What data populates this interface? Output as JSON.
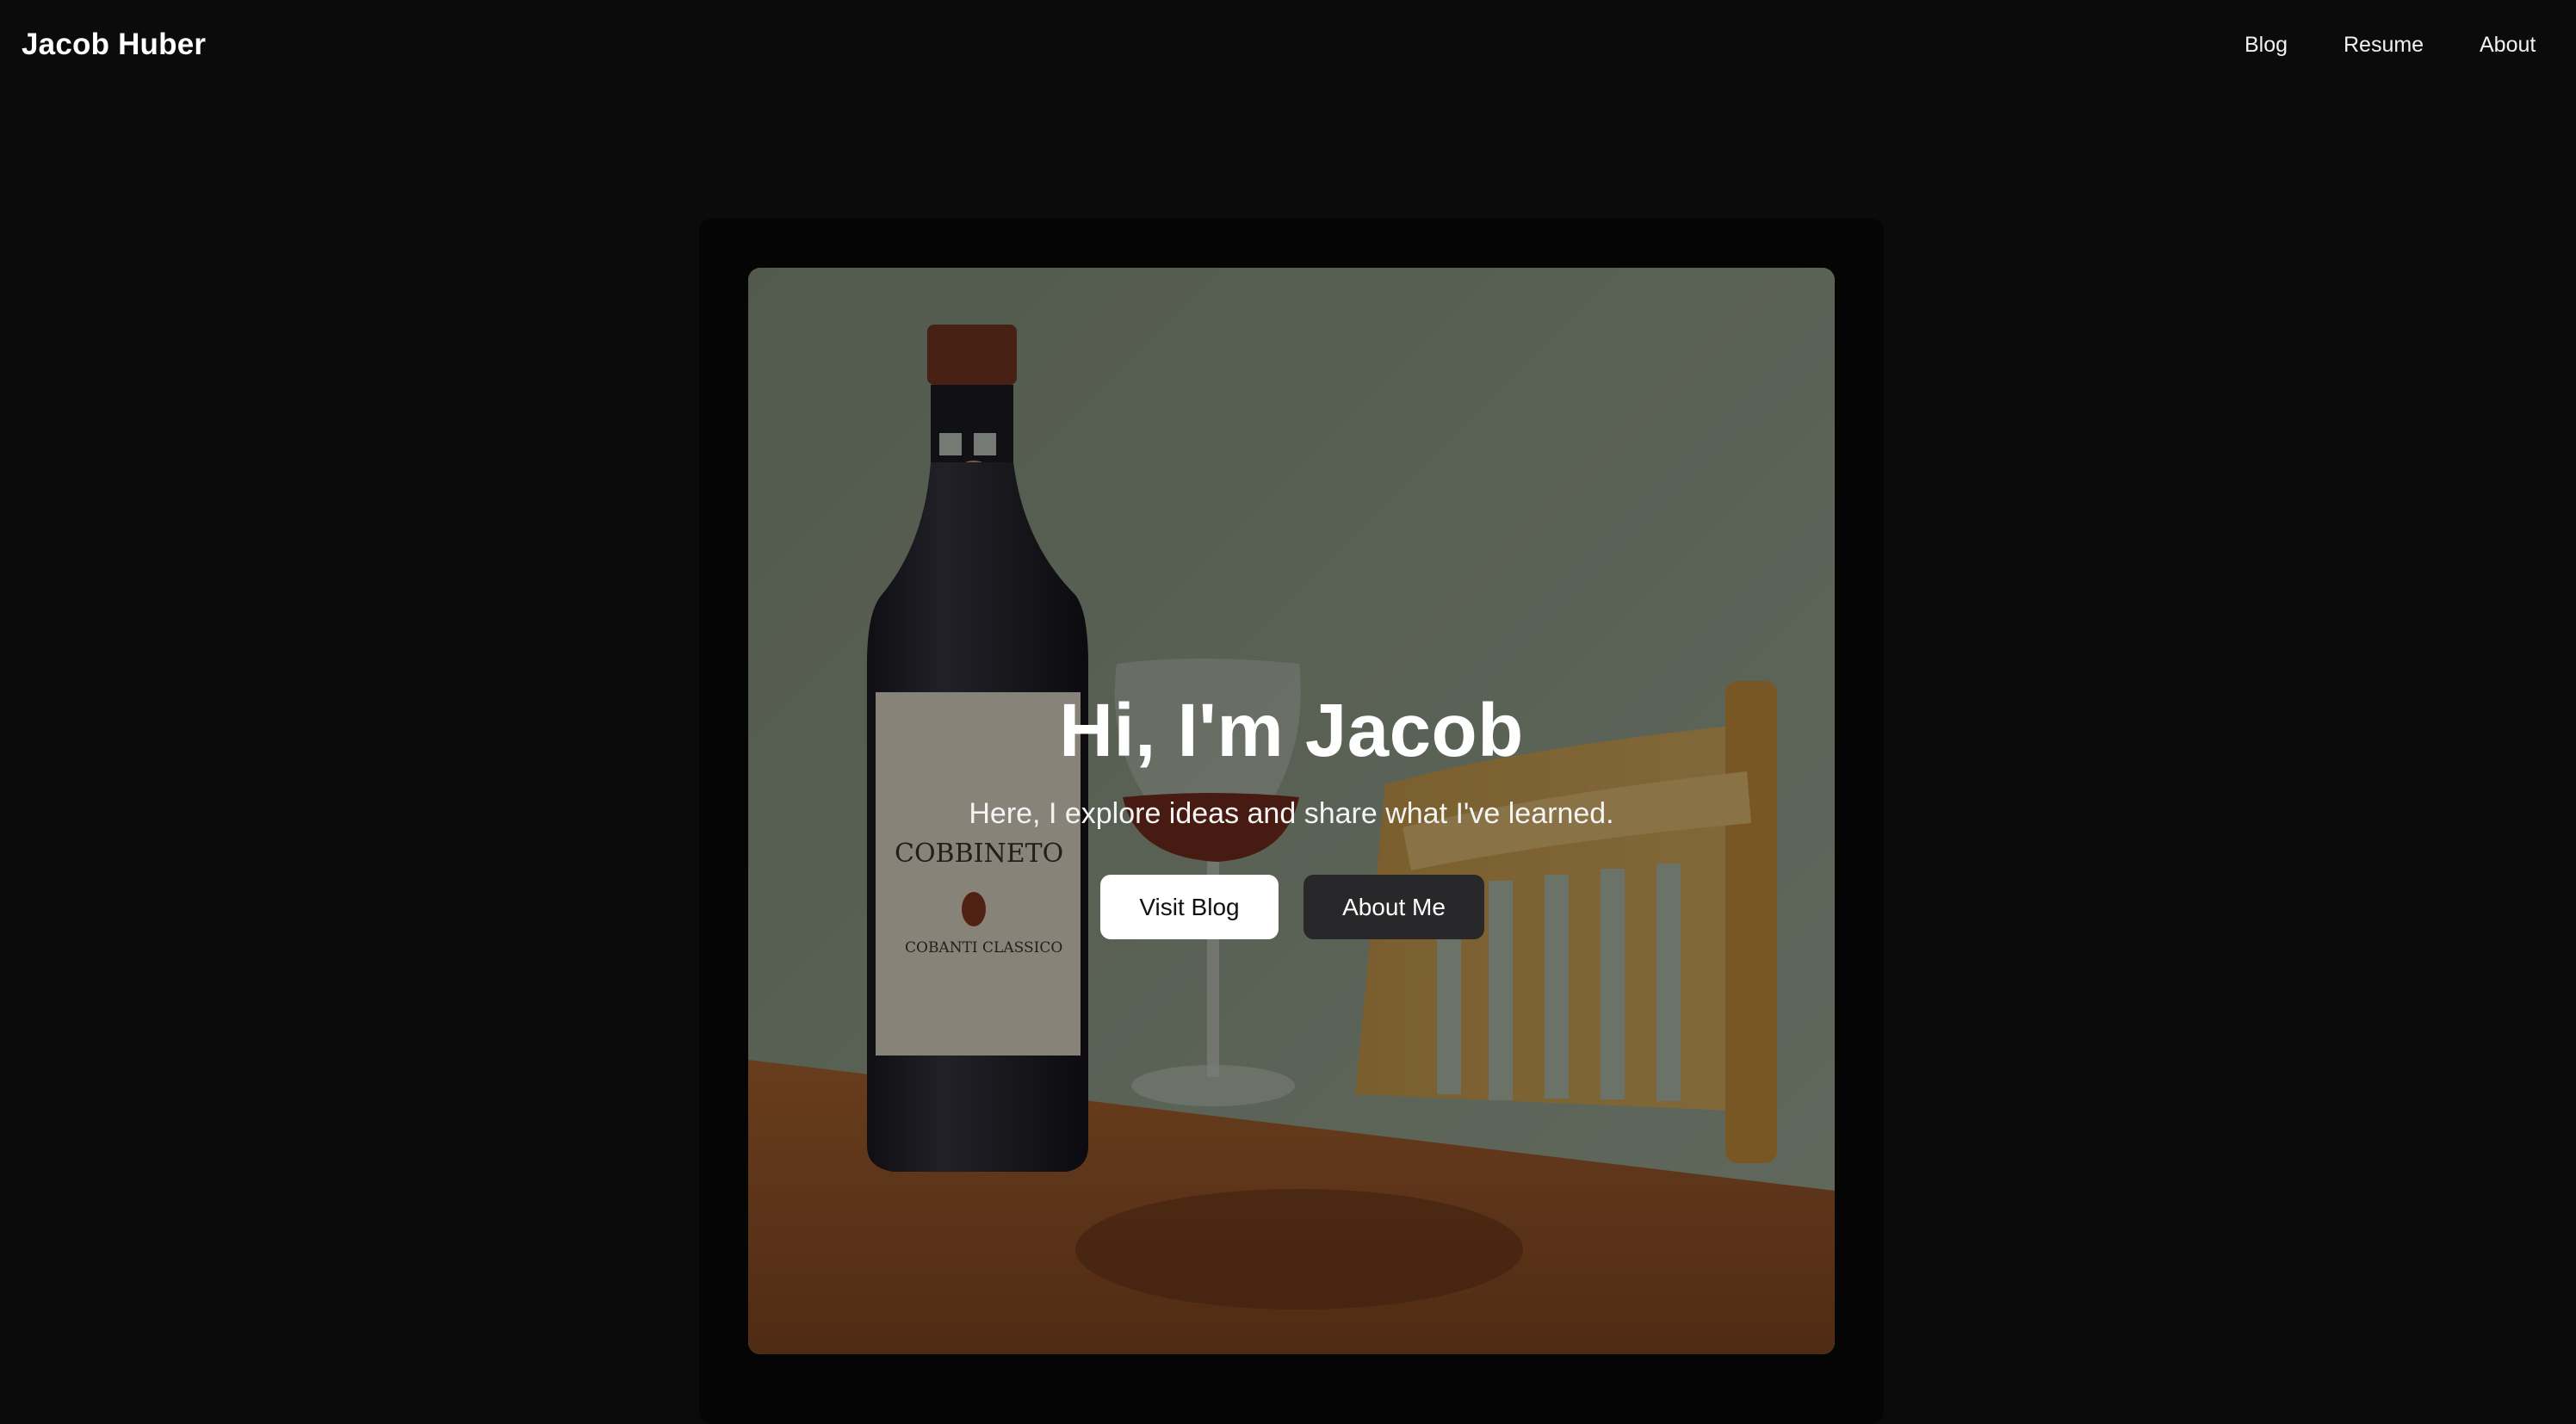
{
  "nav": {
    "brand": "Jacob Huber",
    "links": [
      "Blog",
      "Resume",
      "About"
    ]
  },
  "hero": {
    "title": "Hi, I'm Jacob",
    "subtitle": "Here, I explore ideas and share what I've learned.",
    "primary_button": "Visit Blog",
    "secondary_button": "About Me",
    "image": {
      "subject": "watercolor illustration of a wine bottle, a glass of red wine and a wooden chair on a table",
      "label_brand": "COBBINETO",
      "label_sub": "COBANTI CLASSICO"
    }
  },
  "colors": {
    "page_background": "#0b0b0b",
    "primary_button_bg": "#ffffff",
    "secondary_button_bg": "#28282a",
    "text": "#ffffff"
  }
}
